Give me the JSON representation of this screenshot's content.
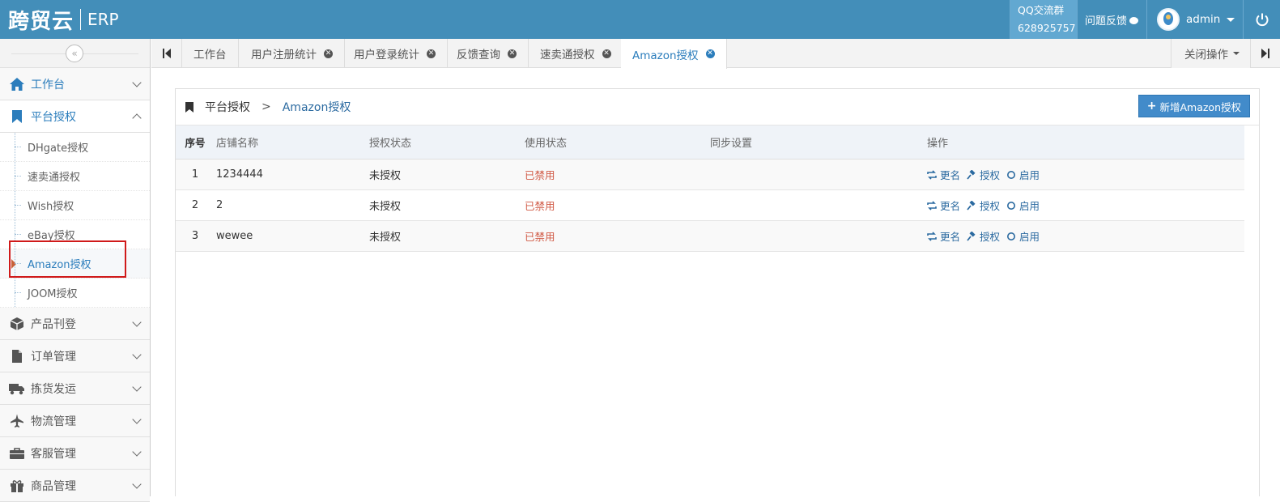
{
  "brand": {
    "logo": "跨贸云",
    "product": "ERP"
  },
  "navbar": {
    "qq_label": "QQ交流群",
    "qq_number": "628925757",
    "feedback": "问题反馈",
    "user": "admin"
  },
  "sidebar": {
    "collapse_glyph": "«",
    "workbench": "工作台",
    "platform_auth": "平台授权",
    "sub_items": [
      "DHgate授权",
      "速卖通授权",
      "Wish授权",
      "eBay授权",
      "Amazon授权",
      "JOOM授权"
    ],
    "modules": [
      "产品刊登",
      "订单管理",
      "拣货发运",
      "物流管理",
      "客服管理",
      "商品管理"
    ]
  },
  "tabs": {
    "items": [
      "工作台",
      "用户注册统计",
      "用户登录统计",
      "反馈查询",
      "速卖通授权",
      "Amazon授权"
    ],
    "close_ops": "关闭操作"
  },
  "panel": {
    "breadcrumb_root": "平台授权",
    "breadcrumb_sep": ">",
    "breadcrumb_current": "Amazon授权",
    "add_button": "新增Amazon授权"
  },
  "table": {
    "headers": [
      "序号",
      "店铺名称",
      "授权状态",
      "使用状态",
      "同步设置",
      "操作"
    ],
    "rows": [
      {
        "no": "1",
        "shop": "1234444",
        "auth": "未授权",
        "use": "已禁用",
        "sync": ""
      },
      {
        "no": "2",
        "shop": "2",
        "auth": "未授权",
        "use": "已禁用",
        "sync": ""
      },
      {
        "no": "3",
        "shop": "wewee",
        "auth": "未授权",
        "use": "已禁用",
        "sync": ""
      }
    ],
    "actions": {
      "rename": "更名",
      "authorize": "授权",
      "enable": "启用"
    }
  },
  "colors": {
    "navbar": "#438eb9",
    "accent": "#2b7dbc",
    "danger": "#d15b47",
    "highlight_box": "#d01a1a"
  }
}
